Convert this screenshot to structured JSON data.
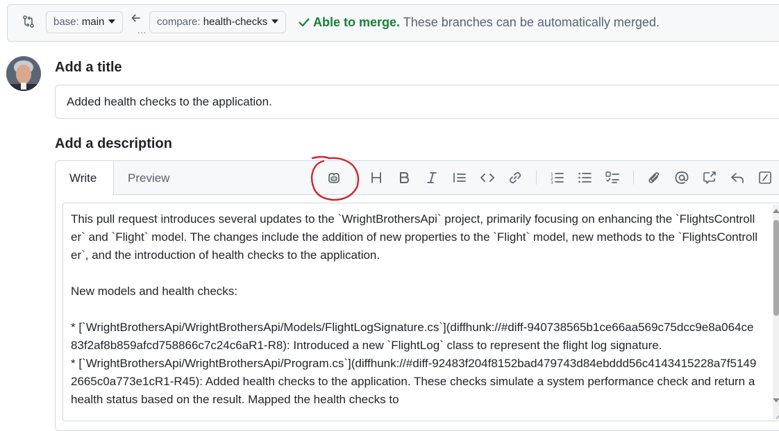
{
  "compare_bar": {
    "icon": "git-compare-icon",
    "base_label": "base:",
    "base_branch": "main",
    "compare_label": "compare:",
    "compare_branch": "health-checks",
    "merge_status": "Able to merge.",
    "merge_description": "These branches can be automatically merged.",
    "ellipsis": "...",
    "colors": {
      "success": "#1a7f37",
      "muted": "#59636e"
    }
  },
  "title_section": {
    "label": "Add a title",
    "value": "Added health checks to the application."
  },
  "description_section": {
    "label": "Add a description",
    "tabs": [
      "Write",
      "Preview"
    ],
    "active_tab": "Write",
    "toolbar_icons": [
      "copilot-icon",
      "heading-icon",
      "bold-icon",
      "italic-icon",
      "quote-icon",
      "code-icon",
      "link-icon",
      "numbered-list-icon",
      "bulleted-list-icon",
      "task-list-icon",
      "attach-icon",
      "mention-icon",
      "cross-reference-icon",
      "saved-reply-icon",
      "slash-command-icon"
    ],
    "body": "This pull request introduces several updates to the `WrightBrothersApi` project, primarily focusing on enhancing the `FlightsController` and `Flight` model. The changes include the addition of new properties to the `Flight` model, new methods to the `FlightsController`, and the introduction of health checks to the application.\n\nNew models and health checks:\n\n* [`WrightBrothersApi/WrightBrothersApi/Models/FlightLogSignature.cs`](diffhunk://#diff-940738565b1ce66aa569c75dcc9e8a064ce83f2af8b859afcd758866c7c24c6aR1-R8): Introduced a new `FlightLog` class to represent the flight log signature.\n* [`WrightBrothersApi/WrightBrothersApi/Program.cs`](diffhunk://#diff-92483f204f8152bad479743d84ebddd56c4143415228a7f51492665c0a773e1cR1-R45): Added health checks to the application. These checks simulate a system performance check and return a health status based on the result. Mapped the health checks to"
  },
  "annotation": {
    "color": "#d1242f"
  }
}
